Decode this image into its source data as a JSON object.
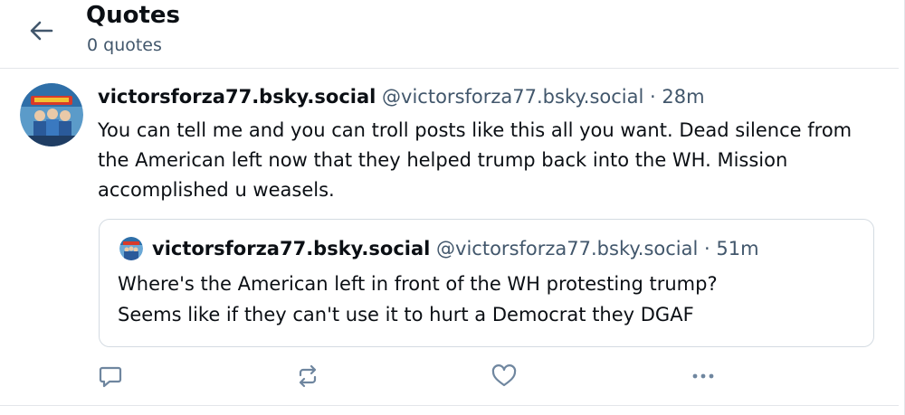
{
  "header": {
    "title": "Quotes",
    "subtitle": "0 quotes",
    "back_icon": "arrow-left-icon"
  },
  "post": {
    "author_name": "victorsforza77.bsky.social",
    "author_handle": "@victorsforza77.bsky.social",
    "separator": "·",
    "time": "28m",
    "text": "You can tell me and you can troll posts like this all you want. Dead silence from the American left now that they helped trump back into the WH. Mission accomplished u weasels.",
    "quote": {
      "author_name": "victorsforza77.bsky.social",
      "author_handle": "@victorsforza77.bsky.social",
      "separator": "·",
      "time": "51m",
      "text_line1": "Where's the American left in front of the WH protesting trump?",
      "text_line2": "Seems like if they can't use it to hurt a Democrat they DGAF"
    },
    "actions": {
      "reply_icon": "reply-bubble-icon",
      "repost_icon": "repost-icon",
      "like_icon": "heart-icon",
      "more_icon": "more-dots-icon"
    }
  },
  "colors": {
    "text": "#0b0f14",
    "muted": "#42576c",
    "icon": "#6f869f",
    "border": "#e3e6ea"
  }
}
